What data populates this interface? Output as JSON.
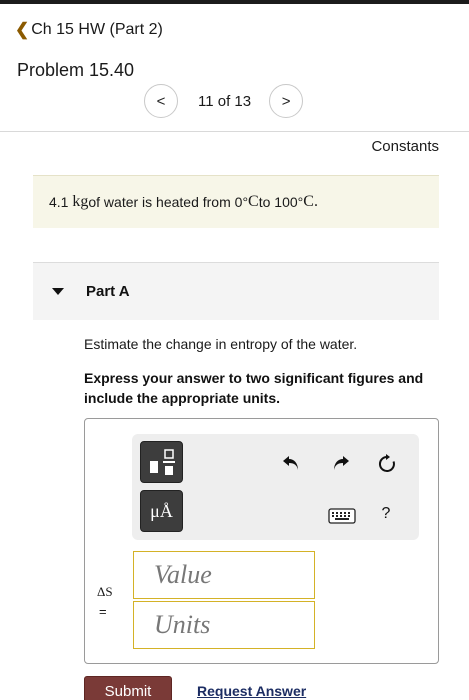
{
  "nav": {
    "back_chevron": "❮",
    "back_label": "Ch 15 HW (Part 2)"
  },
  "problem": {
    "title": "Problem 15.40",
    "pager_prev": "<",
    "pager_count": "11 of 13",
    "pager_next": ">"
  },
  "constants_label": "Constants",
  "statement": {
    "num": "4.1",
    "unit": "kg",
    "text1": " of water is heated from 0",
    "deg1": "°",
    "c1": "C",
    "text2": " to 100",
    "deg2": "°",
    "c2": "C",
    "period": "."
  },
  "part": {
    "label": "Part A",
    "question": "Estimate the change in entropy of the water.",
    "instructions": "Express your answer to two significant figures and include the appropriate units."
  },
  "answer": {
    "units_button": "μÅ",
    "help": "?",
    "delta_symbol": "ΔS",
    "equals": "=",
    "value_placeholder": "Value",
    "units_placeholder": "Units"
  },
  "actions": {
    "submit": "Submit",
    "request": "Request Answer"
  },
  "colors": {
    "accent_chevron": "#8b5a00",
    "statement_bg": "#f7f6e8",
    "field_border": "#d4b227",
    "submit_bg": "#7a3a37",
    "link": "#1c2d63"
  }
}
